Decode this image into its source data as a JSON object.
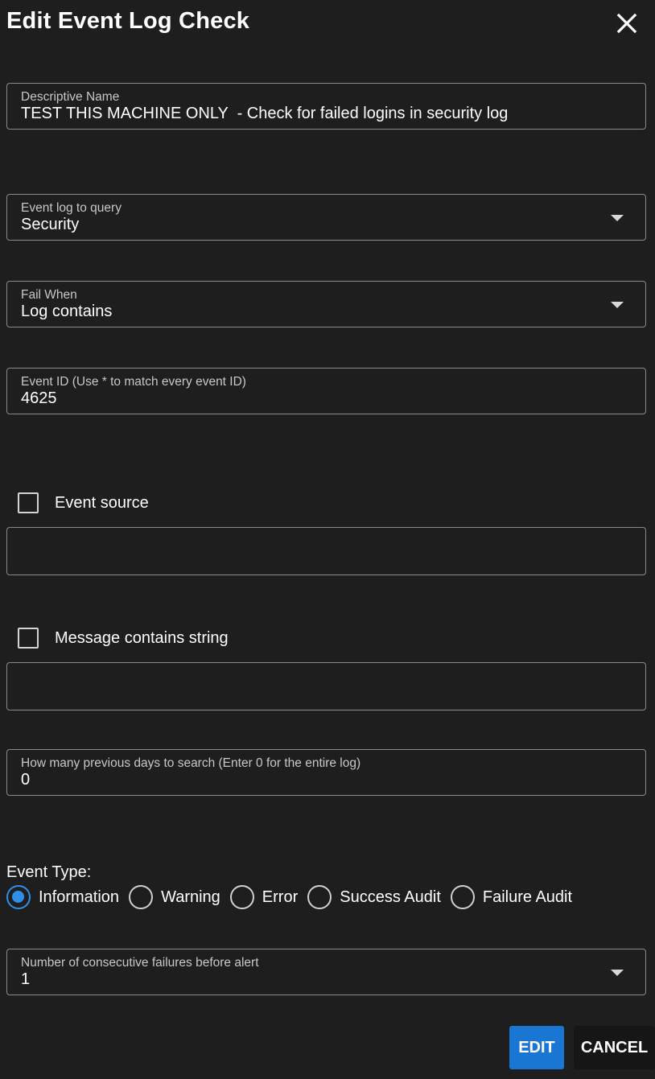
{
  "dialog": {
    "title": "Edit Event Log Check",
    "close_icon": "close-icon"
  },
  "fields": {
    "descriptive_name": {
      "label": "Descriptive Name",
      "value": "TEST THIS MACHINE ONLY  - Check for failed logins in security log"
    },
    "event_log": {
      "label": "Event log to query",
      "value": "Security"
    },
    "fail_when": {
      "label": "Fail When",
      "value": "Log contains"
    },
    "event_id": {
      "label": "Event ID (Use * to match every event ID)",
      "value": "4625"
    },
    "event_source": {
      "checkbox_label": "Event source",
      "checked": false,
      "value": ""
    },
    "message_contains": {
      "checkbox_label": "Message contains string",
      "checked": false,
      "value": ""
    },
    "days": {
      "label": "How many previous days to search (Enter 0 for the entire log)",
      "value": "0"
    },
    "consecutive_failures": {
      "label": "Number of consecutive failures before alert",
      "value": "1"
    }
  },
  "event_type": {
    "title": "Event Type:",
    "options": [
      {
        "label": "Information",
        "selected": true
      },
      {
        "label": "Warning",
        "selected": false
      },
      {
        "label": "Error",
        "selected": false
      },
      {
        "label": "Success Audit",
        "selected": false
      },
      {
        "label": "Failure Audit",
        "selected": false
      }
    ]
  },
  "buttons": {
    "edit": "EDIT",
    "cancel": "CANCEL"
  },
  "colors": {
    "background": "#1e1e1e",
    "accent": "#1976d2",
    "radio_selected": "#2f8fe8",
    "border": "#8a8a8a"
  }
}
